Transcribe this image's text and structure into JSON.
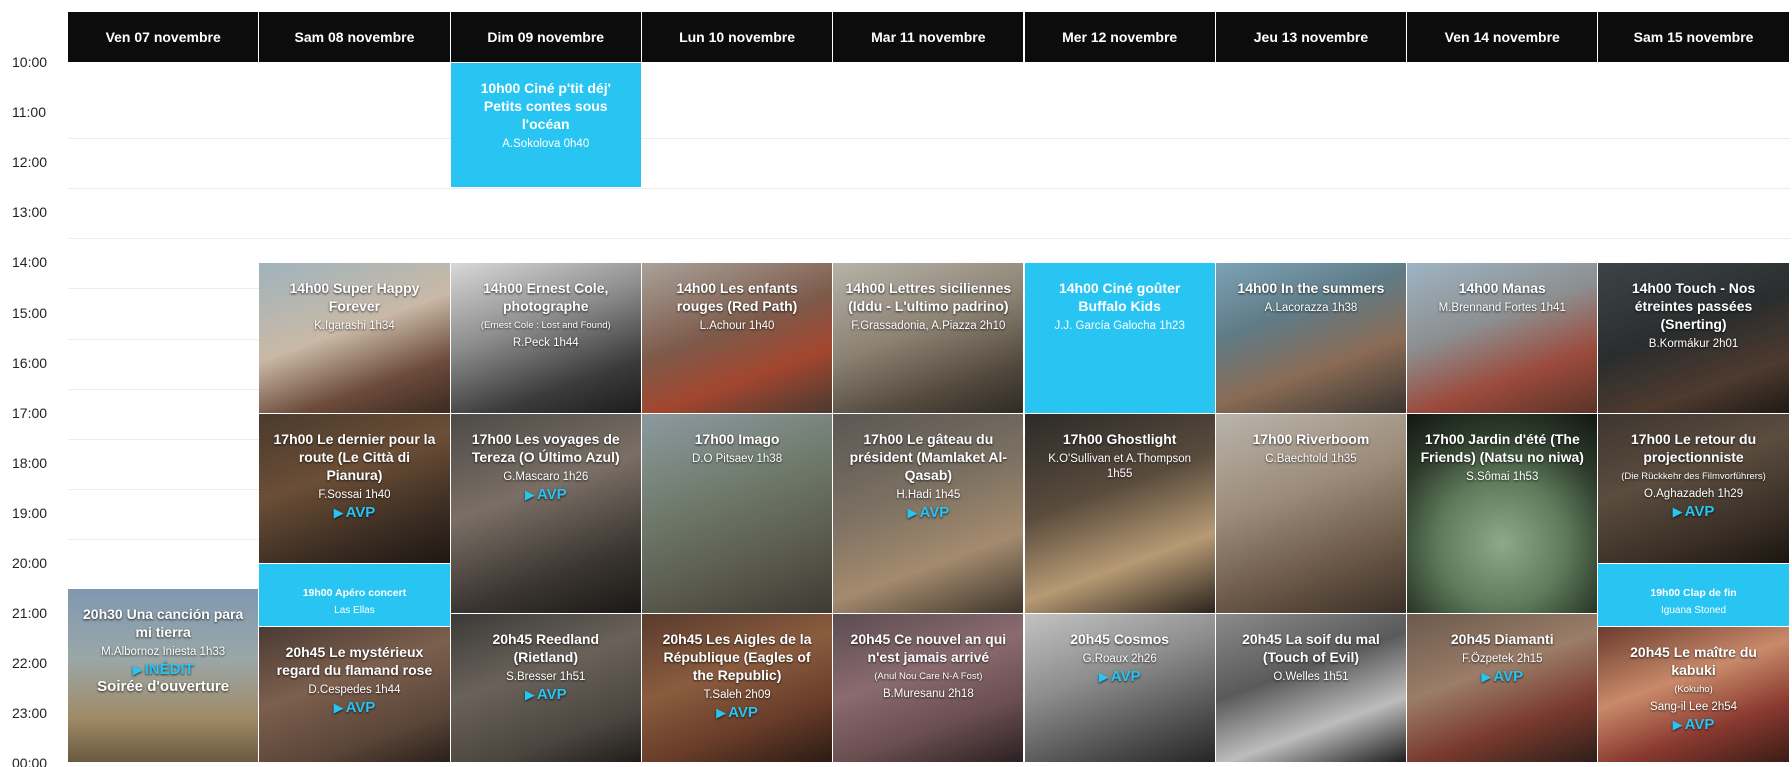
{
  "time_labels": [
    "10:00",
    "11:00",
    "12:00",
    "13:00",
    "14:00",
    "15:00",
    "16:00",
    "17:00",
    "18:00",
    "19:00",
    "20:00",
    "21:00",
    "22:00",
    "23:00",
    "00:00"
  ],
  "days": [
    {
      "id": "ven07",
      "label": "Ven 07 novembre"
    },
    {
      "id": "sam08",
      "label": "Sam 08 novembre"
    },
    {
      "id": "dim09",
      "label": "Dim 09 novembre"
    },
    {
      "id": "lun10",
      "label": "Lun 10 novembre"
    },
    {
      "id": "mar11",
      "label": "Mar 11 novembre"
    },
    {
      "id": "mer12",
      "label": "Mer 12 novembre"
    },
    {
      "id": "jeu13",
      "label": "Jeu 13 novembre"
    },
    {
      "id": "ven14",
      "label": "Ven 14 novembre"
    },
    {
      "id": "sam15",
      "label": "Sam 15 novembre"
    }
  ],
  "colors": {
    "accent": "#28c4f2",
    "header_bg": "#0c0c0c"
  },
  "events": [
    {
      "day": 2,
      "start": 10,
      "end": 12.5,
      "style": "blue",
      "title": "10h00 Ciné p'tit déj' Petits contes sous l'océan",
      "credit": "A.Sokolova 0h40"
    },
    {
      "day": 1,
      "start": 14,
      "end": 17,
      "bg": "linear-gradient(160deg,#9fb3bd 0%,#c9b9a6 45%,#6d4b3b 75%,#3b2a22 100%)",
      "title": "14h00 Super Happy Forever",
      "credit": "K.Igarashi 1h34"
    },
    {
      "day": 2,
      "start": 14,
      "end": 17,
      "bg": "linear-gradient(160deg,#d8d8d8 0%,#8e8e8e 40%,#3c3c3c 75%,#1c1c1c 100%)",
      "title": "14h00 Ernest Cole, photographe",
      "subtitle": "(Ernest Cole : Lost and Found)",
      "credit": "R.Peck 1h44"
    },
    {
      "day": 3,
      "start": 14,
      "end": 17,
      "bg": "linear-gradient(160deg,#a9a29a 0%,#7d5a4a 45%,#a3462f 70%,#4a3a31 100%)",
      "title": "14h00 Les enfants rouges (Red Path)",
      "credit": "L.Achour 1h40"
    },
    {
      "day": 4,
      "start": 14,
      "end": 17,
      "bg": "linear-gradient(160deg,#b8b2a8 0%,#8b8273 45%,#564c40 75%,#2f2a24 100%)",
      "title": "14h00 Lettres siciliennes (Iddu - L'ultimo padrino)",
      "credit": "F.Grassadonia, A.Piazza 2h10"
    },
    {
      "day": 5,
      "start": 14,
      "end": 17,
      "style": "blue",
      "title": "14h00 Ciné goûter Buffalo Kids",
      "credit": "J.J. García Galocha 1h23"
    },
    {
      "day": 6,
      "start": 14,
      "end": 17,
      "bg": "linear-gradient(160deg,#7da3b7 0%,#5f7b86 35%,#8a6b55 65%,#3a3531 100%)",
      "title": "14h00 In the summers",
      "credit": "A.Lacorazza 1h38"
    },
    {
      "day": 7,
      "start": 14,
      "end": 17,
      "bg": "linear-gradient(160deg,#9fb4c4 0%,#8c8f90 40%,#9b4b3d 70%,#5a3328 100%)",
      "title": "14h00 Manas",
      "credit": "M.Brennand Fortes 1h41"
    },
    {
      "day": 8,
      "start": 14,
      "end": 17,
      "bg": "linear-gradient(160deg,#3d4446 0%,#2a2d2e 45%,#4e3a2e 75%,#1e1a17 100%)",
      "title": "14h00 Touch - Nos étreintes passées (Snerting)",
      "credit": "B.Kormákur 2h01"
    },
    {
      "day": 1,
      "start": 17,
      "end": 20,
      "bg": "linear-gradient(160deg,#4a3a2d 0%,#6b4e36 40%,#3a2c22 75%,#1d1713 100%)",
      "title": "17h00 Le dernier pour la route (Le Città di Pianura)",
      "credit": "F.Sossai 1h40",
      "badge": "AVP"
    },
    {
      "day": 2,
      "start": 17,
      "end": 21,
      "bg": "linear-gradient(160deg,#4d4a45 0%,#7a6f66 40%,#3a3530 75%,#1a1816 100%)",
      "title": "17h00 Les voyages de Tereza (O Último Azul)",
      "credit": "G.Mascaro 1h26",
      "badge": "AVP"
    },
    {
      "day": 3,
      "start": 17,
      "end": 21,
      "bg": "linear-gradient(160deg,#8c9aa1 0%,#6f7a6b 40%,#5b5c4f 70%,#3d3b33 100%)",
      "title": "17h00 Imago",
      "credit": "D.O Pitsaev 1h38"
    },
    {
      "day": 4,
      "start": 17,
      "end": 21,
      "bg": "linear-gradient(160deg,#5b5753 0%,#7b7062 40%,#a48b6e 70%,#3e352c 100%)",
      "title": "17h00 Le gâteau du président (Mamlaket Al-Qasab)",
      "credit": "H.Hadi 1h45",
      "badge": "AVP"
    },
    {
      "day": 5,
      "start": 17,
      "end": 21,
      "bg": "linear-gradient(160deg,#2c2a28 0%,#5a4c3d 40%,#b79a74 70%,#2b241d 100%)",
      "title": "17h00 Ghostlight",
      "credit": "K.O'Sullivan et A.Thompson 1h55"
    },
    {
      "day": 6,
      "start": 17,
      "end": 21,
      "bg": "linear-gradient(160deg,#b9b4ac 0%,#9c8b78 40%,#6e5b4a 70%,#3b3028 100%)",
      "title": "17h00 Riverboom",
      "credit": "C.Baechtold 1h35"
    },
    {
      "day": 7,
      "start": 17,
      "end": 21,
      "bg": "radial-gradient(circle at 50% 65%,#8ea98a 0%,#5d7a5a 40%,#2d3b2b 70%,#121612 100%)",
      "title": "17h00 Jardin d'été (The Friends) (Natsu no niwa)",
      "credit": "S.Sômai 1h53"
    },
    {
      "day": 8,
      "start": 17,
      "end": 20,
      "bg": "linear-gradient(160deg,#3d3630 0%,#5b4c3e 40%,#3a2f26 75%,#1a1511 100%)",
      "title": "17h00 Le retour du projectionniste",
      "subtitle": "(Die Rückkehr des Filmvorführers)",
      "credit": "O.Aghazadeh 1h29",
      "badge": "AVP"
    },
    {
      "day": 1,
      "start": 20,
      "end": 21.25,
      "style": "blue",
      "small": true,
      "title": "19h00 Apéro concert",
      "credit": "Las Ellas"
    },
    {
      "day": 8,
      "start": 20,
      "end": 21.25,
      "style": "blue",
      "small": true,
      "title": "19h00 Clap de fin",
      "credit": "Iguana Stoned"
    },
    {
      "day": 0,
      "start": 20.5,
      "end": 24,
      "bg": "linear-gradient(180deg,#7f98b0 0%,#9aa7a8 40%,#a08a66 75%,#6a5a40 100%)",
      "title": "20h30 Una canción para mi tierra",
      "credit": "M.Albornoz Iniesta 1h33",
      "badge": "INÉDIT",
      "extra": "Soirée d'ouverture"
    },
    {
      "day": 1,
      "start": 21.25,
      "end": 24,
      "bg": "linear-gradient(160deg,#4a3b33 0%,#7c5f4d 40%,#5a4538 75%,#2a201b 100%)",
      "title": "20h45 Le mystérieux regard du flamand rose",
      "credit": "D.Cespedes 1h44",
      "badge": "AVP"
    },
    {
      "day": 2,
      "start": 21,
      "end": 24,
      "bg": "linear-gradient(160deg,#3b3a38 0%,#6a625a 40%,#4c4640 75%,#1f1d1b 100%)",
      "title": "20h45 Reedland (Rietland)",
      "credit": "S.Bresser 1h51",
      "badge": "AVP"
    },
    {
      "day": 3,
      "start": 21,
      "end": 24,
      "bg": "linear-gradient(160deg,#5a3b2d 0%,#8a5c3e 40%,#6a3d2a 70%,#2b1b14 100%)",
      "title": "20h45 Les Aigles de la République (Eagles of the Republic)",
      "credit": "T.Saleh 2h09",
      "badge": "AVP"
    },
    {
      "day": 4,
      "start": 21,
      "end": 24,
      "bg": "linear-gradient(160deg,#5b4c52 0%,#8a6b6f 40%,#6a4e50 70%,#2b2022 100%)",
      "title": "20h45 Ce nouvel an qui n'est jamais arrivé",
      "subtitle": "(Anul Nou Care N-A Fost)",
      "credit": "B.Muresanu 2h18"
    },
    {
      "day": 5,
      "start": 21,
      "end": 24,
      "bg": "linear-gradient(160deg,#c2c2c2 0%,#8e8e8e 40%,#5a5a5a 70%,#262626 100%)",
      "title": "20h45 Cosmos",
      "credit": "G.Roaux 2h26",
      "badge": "AVP"
    },
    {
      "day": 6,
      "start": 21,
      "end": 24,
      "bg": "linear-gradient(160deg,#8a8a8a 0%,#5a5a5a 40%,#bdbdbd 70%,#1f1f1f 100%)",
      "title": "20h45 La soif du mal (Touch of Evil)",
      "credit": "O.Welles 1h51"
    },
    {
      "day": 7,
      "start": 21,
      "end": 24,
      "bg": "linear-gradient(160deg,#6a5a4e 0%,#9b7d68 40%,#7a3a2e 70%,#2d1f1a 100%)",
      "title": "20h45 Diamanti",
      "credit": "F.Özpetek 2h15",
      "badge": "AVP"
    },
    {
      "day": 8,
      "start": 21.25,
      "end": 24,
      "bg": "linear-gradient(160deg,#6a3b2d 0%,#c98a6a 40%,#8a3a30 70%,#3b1c17 100%)",
      "title": "20h45 Le maître du kabuki",
      "subtitle": "(Kokuho)",
      "credit": "Sang-il Lee 2h54",
      "badge": "AVP"
    }
  ]
}
